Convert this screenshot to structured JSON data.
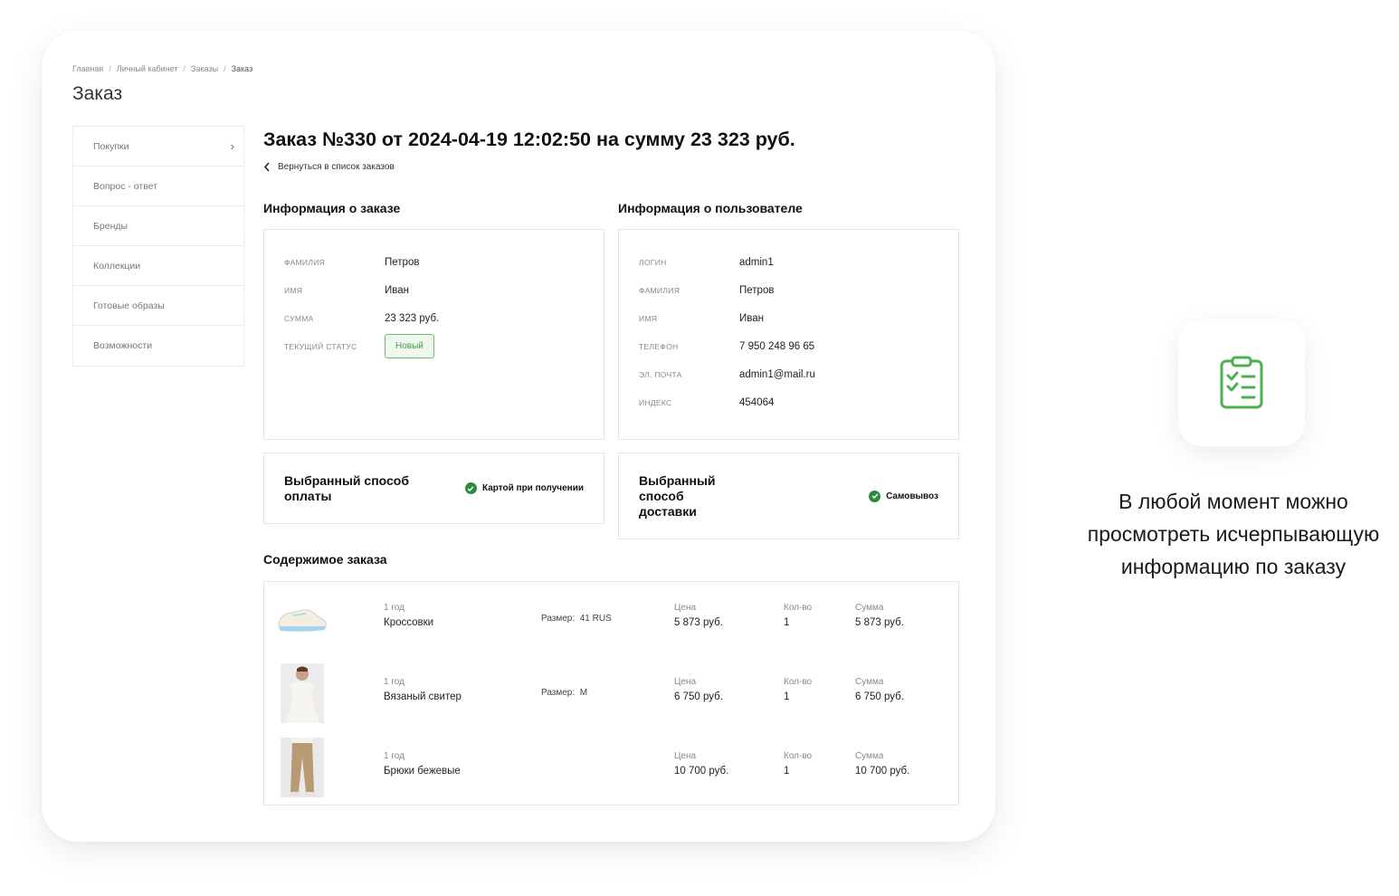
{
  "breadcrumb": [
    "Главная",
    "Личный кабинет",
    "Заказы",
    "Заказ"
  ],
  "page_title": "Заказ",
  "sidebar": {
    "items": [
      {
        "label": "Покупки"
      },
      {
        "label": "Вопрос - ответ"
      },
      {
        "label": "Бренды"
      },
      {
        "label": "Коллекции"
      },
      {
        "label": "Готовые образы"
      },
      {
        "label": "Возможности"
      }
    ]
  },
  "order": {
    "title": "Заказ №330 от 2024-04-19 12:02:50 на сумму 23 323 руб.",
    "back_label": "Вернуться в список заказов"
  },
  "order_info": {
    "title": "Информация о заказе",
    "rows": [
      {
        "key": "Фамилия",
        "value": "Петров"
      },
      {
        "key": "Имя",
        "value": "Иван"
      },
      {
        "key": "Сумма",
        "value": "23 323 руб."
      }
    ],
    "status_key": "Текущий статус",
    "status_value": "Новый"
  },
  "user_info": {
    "title": "Информация о пользователе",
    "rows": [
      {
        "key": "Логин",
        "value": "admin1"
      },
      {
        "key": "Фамилия",
        "value": "Петров"
      },
      {
        "key": "Имя",
        "value": "Иван"
      },
      {
        "key": "Телефон",
        "value": "7 950 248 96 65"
      },
      {
        "key": "Эл. почта",
        "value": "admin1@mail.ru"
      },
      {
        "key": "Индекс",
        "value": "454064"
      }
    ]
  },
  "payment": {
    "title": "Выбранный способ оплаты",
    "value": "Картой при получении"
  },
  "delivery": {
    "title": "Выбранный способ доставки",
    "value": "Самовывоз"
  },
  "contents": {
    "title": "Содержимое заказа",
    "items": [
      {
        "qty_label": "1 год",
        "name": "Кроссовки",
        "size_label": "Размер:",
        "size": "41 RUS",
        "price_label": "Цена",
        "price": "5 873 руб.",
        "count_label": "Кол-во",
        "count": "1",
        "sum_label": "Сумма",
        "sum": "5 873 руб."
      },
      {
        "qty_label": "1 год",
        "name": "Вязаный свитер",
        "size_label": "Размер:",
        "size": "M",
        "price_label": "Цена",
        "price": "6 750 руб.",
        "count_label": "Кол-во",
        "count": "1",
        "sum_label": "Сумма",
        "sum": "6 750 руб."
      },
      {
        "qty_label": "1 год",
        "name": "Брюки бежевые",
        "size_label": "",
        "size": "",
        "price_label": "Цена",
        "price": "10 700 руб.",
        "count_label": "Кол-во",
        "count": "1",
        "sum_label": "Сумма",
        "sum": "10 700 руб."
      }
    ]
  },
  "promo": {
    "icon": "clipboard-checklist-icon",
    "text": "В любой момент можно просмотреть исчерпывающую информацию по заказу"
  },
  "colors": {
    "accent": "#4caf50",
    "check": "#2e8b3e"
  }
}
